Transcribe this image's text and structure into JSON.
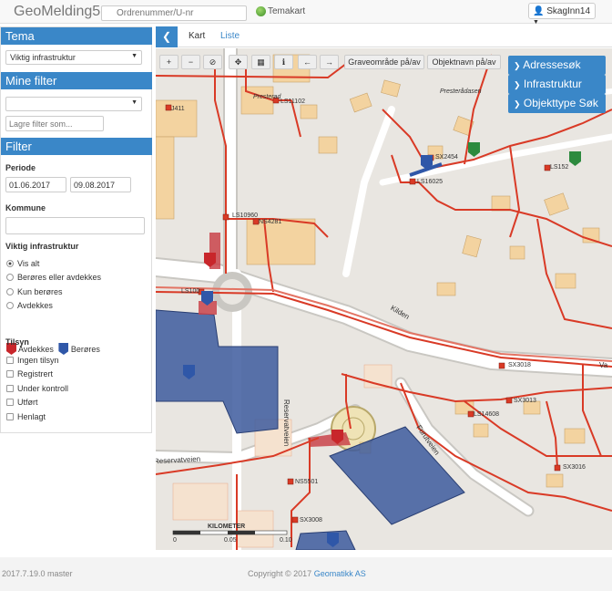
{
  "header": {
    "brand": "GeoMelding5",
    "search_placeholder": "Ordrenummer/U-nr",
    "temakart_label": "Temakart",
    "user_label": "SkagInn14"
  },
  "sidebar": {
    "tema_title": "Tema",
    "tema_value": "Viktig infrastruktur",
    "mine_filter_title": "Mine filter",
    "mine_filter_value": "",
    "save_filter_placeholder": "Lagre filter som...",
    "filter_title": "Filter",
    "periode_label": "Periode",
    "date_from": "01.06.2017",
    "date_to": "09.08.2017",
    "kommune_label": "Kommune",
    "kommune_value": "",
    "infra_label": "Viktig infrastruktur",
    "infra_options": [
      "Vis alt",
      "Berøres eller avdekkes",
      "Kun berøres",
      "Avdekkes"
    ],
    "infra_selected": "Vis alt",
    "legend_avdekkes": "Avdekkes",
    "legend_berores": "Berøres",
    "tilsyn_label": "Tilsyn",
    "tilsyn_options": [
      "Ingen tilsyn",
      "Registrert",
      "Under kontroll",
      "Utført",
      "Henlagt"
    ]
  },
  "tabs": {
    "kart": "Kart",
    "liste": "Liste"
  },
  "map_toolbar": {
    "zoom_in": "+",
    "zoom_out": "−",
    "graveomrade_toggle": "Graveområde på/av",
    "objektnavn_toggle": "Objektnavn på/av"
  },
  "right_panels": {
    "adressesok": "Adressesøk",
    "infrastruktur": "Infrastruktur",
    "objekttype_sok": "Objekttype Søk"
  },
  "map_labels": {
    "ls11102": "LS11102",
    "j411": "J411",
    "ns4281": "NS4281",
    "ls10960": "LS10960",
    "sx2454": "SX2454",
    "ls16025": "LS16025",
    "ls152": "LS152",
    "ls1000": "LS100",
    "sx3018": "SX3018",
    "sx3013": "SX3013",
    "ls14608": "LS14608",
    "sx3016": "SX3016",
    "ns5501": "NS5501",
    "sx3008": "SX3008",
    "kilden": "Kilden",
    "reservatveien_v": "Reservatveien",
    "reservatveien_h": "Reservatveien",
    "furutveien": "Furutveien",
    "presteradasen": "Presterådasen",
    "presterad": "Presterad",
    "va": "Va",
    "scale_title": "KILOMETER",
    "scale_0": "0",
    "scale_005": "0.05",
    "scale_010": "0.10"
  },
  "footer": {
    "version": "2017.7.19.0 master",
    "copyright": "Copyright © 2017",
    "company": "Geomatikk AS"
  },
  "colors": {
    "primary": "#3a87c8",
    "avdekkes": "#c8262b",
    "berores": "#2f57a8",
    "cable": "#d93a26",
    "building": "#f3d3a0",
    "dig_area": "#3d5a9e"
  }
}
